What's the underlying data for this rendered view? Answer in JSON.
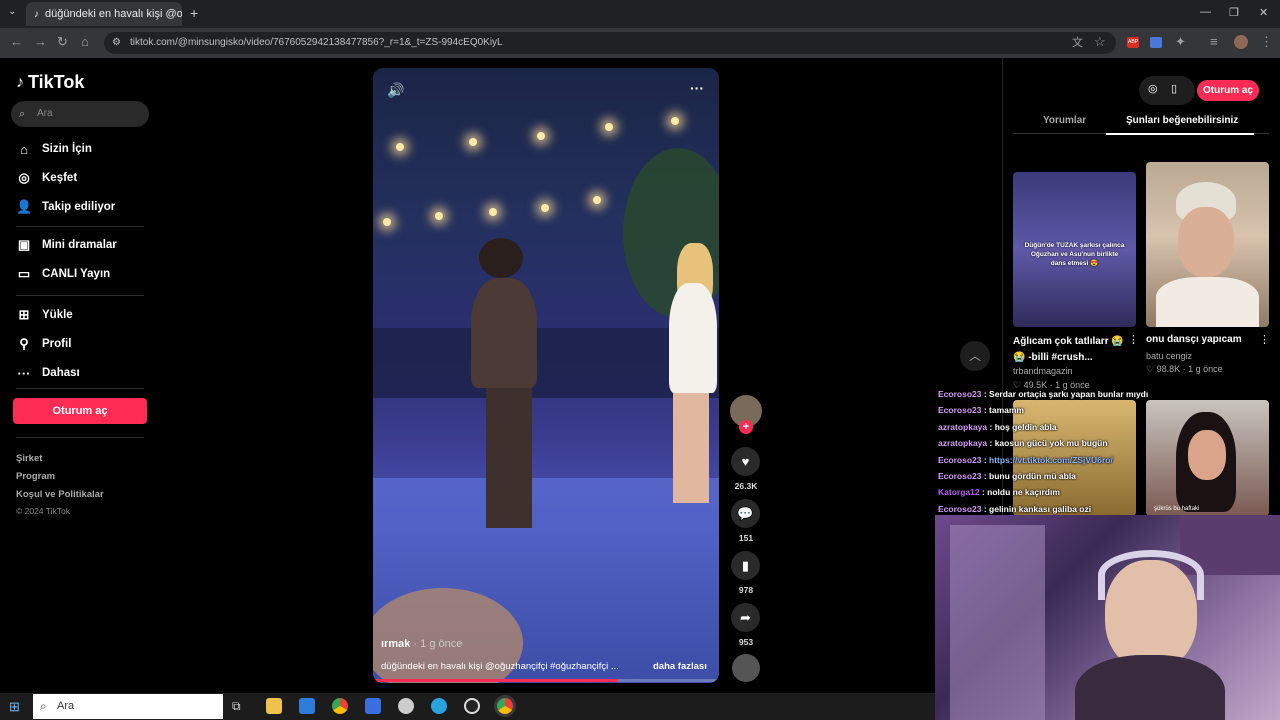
{
  "browser": {
    "tab_title": "düğündeki en havalı kişi @oğuz",
    "url": "tiktok.com/@minsungisko/video/7676052942138477856?_r=1&_t=ZS-994cEQ0KiyL"
  },
  "sidebar": {
    "brand": "TikTok",
    "search_placeholder": "Ara",
    "items": [
      {
        "label": "Sizin İçin",
        "icon": "home-icon"
      },
      {
        "label": "Keşfet",
        "icon": "compass-icon"
      },
      {
        "label": "Takip ediliyor",
        "icon": "user-plus-icon"
      },
      {
        "label": "Mini dramalar",
        "icon": "film-icon"
      },
      {
        "label": "CANLI Yayın",
        "icon": "tv-icon"
      },
      {
        "label": "Yükle",
        "icon": "plus-square-icon"
      },
      {
        "label": "Profil",
        "icon": "user-icon"
      },
      {
        "label": "Dahası",
        "icon": "more-icon"
      }
    ],
    "login_label": "Oturum aç",
    "footer": [
      "Şirket",
      "Program",
      "Koşul ve Politikalar",
      "© 2024 TikTok"
    ]
  },
  "video": {
    "author": "ırmak",
    "time": "· 1 g önce",
    "description": "düğündeki en havalı kişi @oğuzhançifçi #oğuzhançifçi ...",
    "more_label": "daha fazlası"
  },
  "actions": {
    "likes": "26.3K",
    "comments": "151",
    "saves": "978",
    "shares": "953"
  },
  "right_panel": {
    "login_label": "Oturum aç",
    "tab_comments": "Yorumlar",
    "tab_suggested": "Şunları beğenebilirsiniz",
    "cards": [
      {
        "title": "Ağlıcam çok tatlılarr 😭 😭 -billi #crush...",
        "author": "trbandmagazin",
        "likes": "49.5K",
        "time": "1 g önce",
        "overlay": "Düğün'de TUZAK şarkısı çalınca Oğuzhan ve Asu'nun birlikte dans etmesi 😍"
      },
      {
        "title": "onu dansçı yapıcam",
        "author": "batu cengiz",
        "likes": "98.8K",
        "time": "1 g önce",
        "overlay": ""
      },
      {
        "title": "",
        "author": "",
        "likes": "",
        "time": "",
        "overlay": ""
      },
      {
        "title": "",
        "author": "",
        "likes": "",
        "time": "",
        "overlay": "şükrüs bu haftaki"
      }
    ]
  },
  "chat": [
    {
      "user": "Ecoroso23",
      "msg": "Serdar ortaçia şarkı yapan bunlar mıydı",
      "color": "#d59cf6"
    },
    {
      "user": "Ecoroso23",
      "msg": "tamamm",
      "color": "#d59cf6"
    },
    {
      "user": "azratopkaya",
      "msg": "hoş geldin abla",
      "color": "#d59cf6"
    },
    {
      "user": "azratopkaya",
      "msg": "kaosun gücü yok mu bugün",
      "color": "#d59cf6"
    },
    {
      "user": "Ecoroso23",
      "msg": "https://vt.tiktok.com/ZSjVU6ro/",
      "color": "#d59cf6",
      "link": true
    },
    {
      "user": "Ecoroso23",
      "msg": "bunu gördün mü abla",
      "color": "#d59cf6"
    },
    {
      "user": "Katorga12",
      "msg": "noldu ne kaçırdım",
      "color": "#b45cf0"
    },
    {
      "user": "Ecoroso23",
      "msg": "gelinin kankası galiba ozi",
      "color": "#d59cf6"
    }
  ],
  "taskbar": {
    "search_placeholder": "Ara"
  },
  "colors": {
    "accent": "#fe2c55",
    "chat_user": "#d59cf6",
    "link": "#8ab4ff"
  }
}
